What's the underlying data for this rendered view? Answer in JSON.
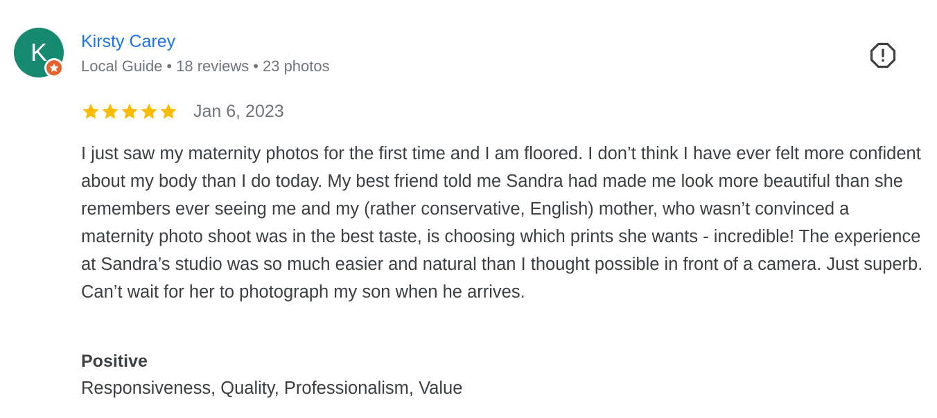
{
  "review": {
    "author": {
      "initial": "K",
      "name": "Kirsty Carey",
      "role": "Local Guide",
      "reviews": "18 reviews",
      "photos": "23 photos",
      "separator": "•",
      "avatar_color": "#168a70",
      "badge_color": "#e5622c",
      "name_color": "#1a73e8"
    },
    "rating": {
      "stars": 5,
      "max": 5,
      "star_color": "#fbbc04"
    },
    "date": "Jan 6, 2023",
    "text": "I just saw my maternity photos for the first time and I am floored. I don’t think I have ever felt more confident about my body than I do today. My best friend told me Sandra had made me look more beautiful than she remembers ever seeing me and my (rather conservative, English) mother, who wasn’t convinced a maternity photo shoot was in the best taste, is choosing which prints she wants - incredible! The experience at Sandra’s studio was so much easier and natural than I thought possible in front of a camera. Just superb. Can’t wait for her to photograph my son when he arrives.",
    "attributes": {
      "heading": "Positive",
      "values": "Responsiveness, Quality, Professionalism, Value"
    },
    "icons": {
      "flag": "report-flag-icon",
      "badge": "local-guide-star-icon",
      "star": "star-icon"
    }
  }
}
